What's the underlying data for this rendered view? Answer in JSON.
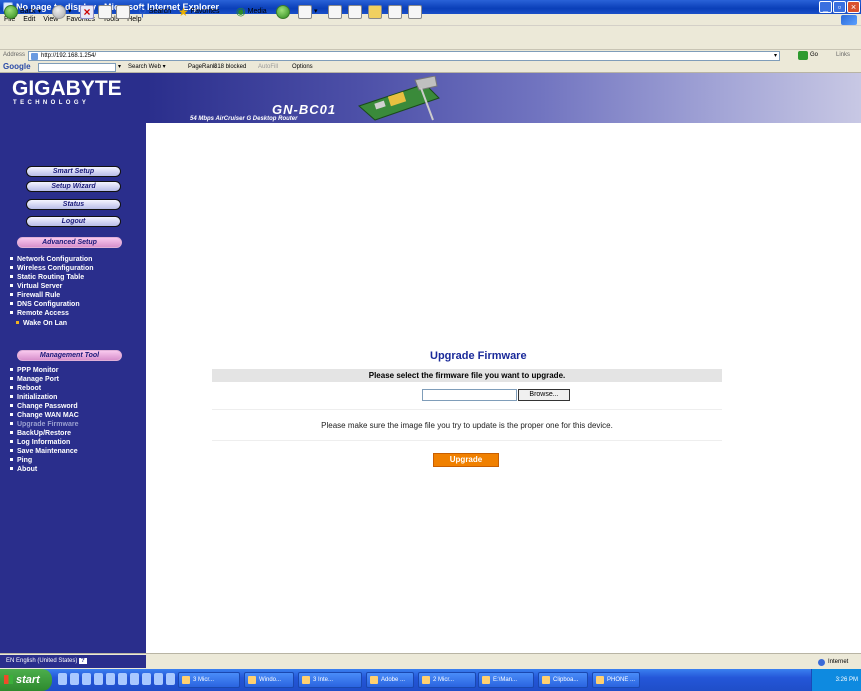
{
  "window": {
    "title": "No page to display - Microsoft Internet Explorer"
  },
  "menu": [
    "File",
    "Edit",
    "View",
    "Favorites",
    "Tools",
    "Help"
  ],
  "toolbar": {
    "back": "Back",
    "search": "Search",
    "favorites": "Favorites",
    "media": "Media"
  },
  "address": {
    "label": "Address",
    "url": "http://192.168.1.254/",
    "go": "Go",
    "links": "Links"
  },
  "google": {
    "logo": "Google",
    "search_web": "Search Web",
    "pagerank": "PageRank",
    "blocked": "318 blocked",
    "autofill": "AutoFill",
    "options": "Options"
  },
  "banner": {
    "brand": "GIGABYTE",
    "brand_sub": "TECHNOLOGY",
    "model": "GN-BC01",
    "model_sub": "54 Mbps AirCruiser G Desktop Router"
  },
  "nav": {
    "buttons": [
      "Smart Setup",
      "Setup Wizard",
      "Status",
      "Logout"
    ],
    "advanced_title": "Advanced Setup",
    "advanced": [
      "Network Configuration",
      "Wireless Configuration",
      "Static Routing Table",
      "Virtual Server",
      "Firewall Rule",
      "DNS Configuration",
      "Remote Access"
    ],
    "advanced_sub": "Wake On Lan",
    "management_title": "Management Tool",
    "management": [
      "PPP Monitor",
      "Manage Port",
      "Reboot",
      "Initialization",
      "Change Password",
      "Change WAN MAC",
      "Upgrade Firmware",
      "BackUp/Restore",
      "Log Information",
      "Save Maintenance",
      "Ping",
      "About"
    ]
  },
  "content": {
    "title": "Upgrade Firmware",
    "prompt": "Please select the firmware file you want to upgrade.",
    "file_value": "",
    "browse": "Browse...",
    "note": "Please make sure the image file you try to update is the proper one for this device.",
    "upgrade": "Upgrade"
  },
  "status": {
    "language": "EN English (United States)",
    "zone": "Internet"
  },
  "taskbar": {
    "start": "start",
    "tasks": [
      "3 Micr...",
      "Windo...",
      "3 Inte...",
      "Adobe ...",
      "2 Micr...",
      "E:\\Man...",
      "Clipboa...",
      "PHONE ..."
    ],
    "clock": "3:26 PM"
  },
  "colors": {
    "sidebar": "#2a2e8c",
    "accent_button": "#f08000",
    "title_blue": "#1a2a9a"
  }
}
